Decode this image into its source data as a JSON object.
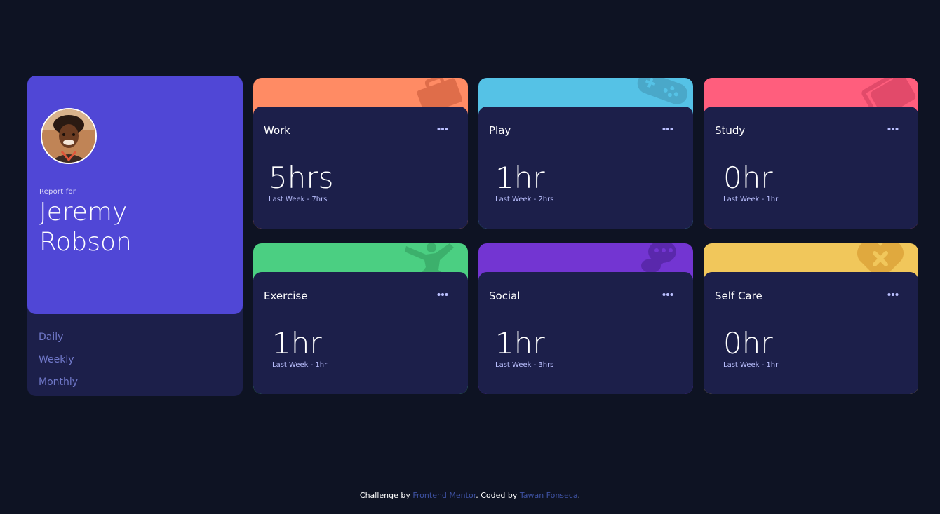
{
  "profile": {
    "report_for": "Report for",
    "name": "Jeremy Robson",
    "periods": [
      "Daily",
      "Weekly",
      "Monthly"
    ]
  },
  "cards": [
    {
      "title": "Work",
      "current": "5hrs",
      "previous": "Last Week - 7hrs",
      "color": "#ff8b64",
      "icon": "work-briefcase-icon"
    },
    {
      "title": "Play",
      "current": "1hr",
      "previous": "Last Week - 2hrs",
      "color": "#55c2e6",
      "icon": "play-gamepad-icon"
    },
    {
      "title": "Study",
      "current": "0hr",
      "previous": "Last Week - 1hr",
      "color": "#ff5e7d",
      "icon": "study-book-icon"
    },
    {
      "title": "Exercise",
      "current": "1hr",
      "previous": "Last Week - 1hr",
      "color": "#4bcf82",
      "icon": "exercise-runner-icon"
    },
    {
      "title": "Social",
      "current": "1hr",
      "previous": "Last Week - 3hrs",
      "color": "#7335d2",
      "icon": "social-chat-icon"
    },
    {
      "title": "Self Care",
      "current": "0hr",
      "previous": "Last Week - 1hr",
      "color": "#f1c75b",
      "icon": "self-care-heart-icon"
    }
  ],
  "footer": {
    "prefix": "Challenge by ",
    "link1": "Frontend Mentor",
    "middle": ". Coded by ",
    "link2": "Tawan Fonseca",
    "suffix": "."
  },
  "colors": {
    "background": "#0e1323",
    "card": "#1c1f4a",
    "profile_accent": "#5047d6",
    "muted_text": "#7078c9",
    "pale_text": "#bbc0ff"
  }
}
